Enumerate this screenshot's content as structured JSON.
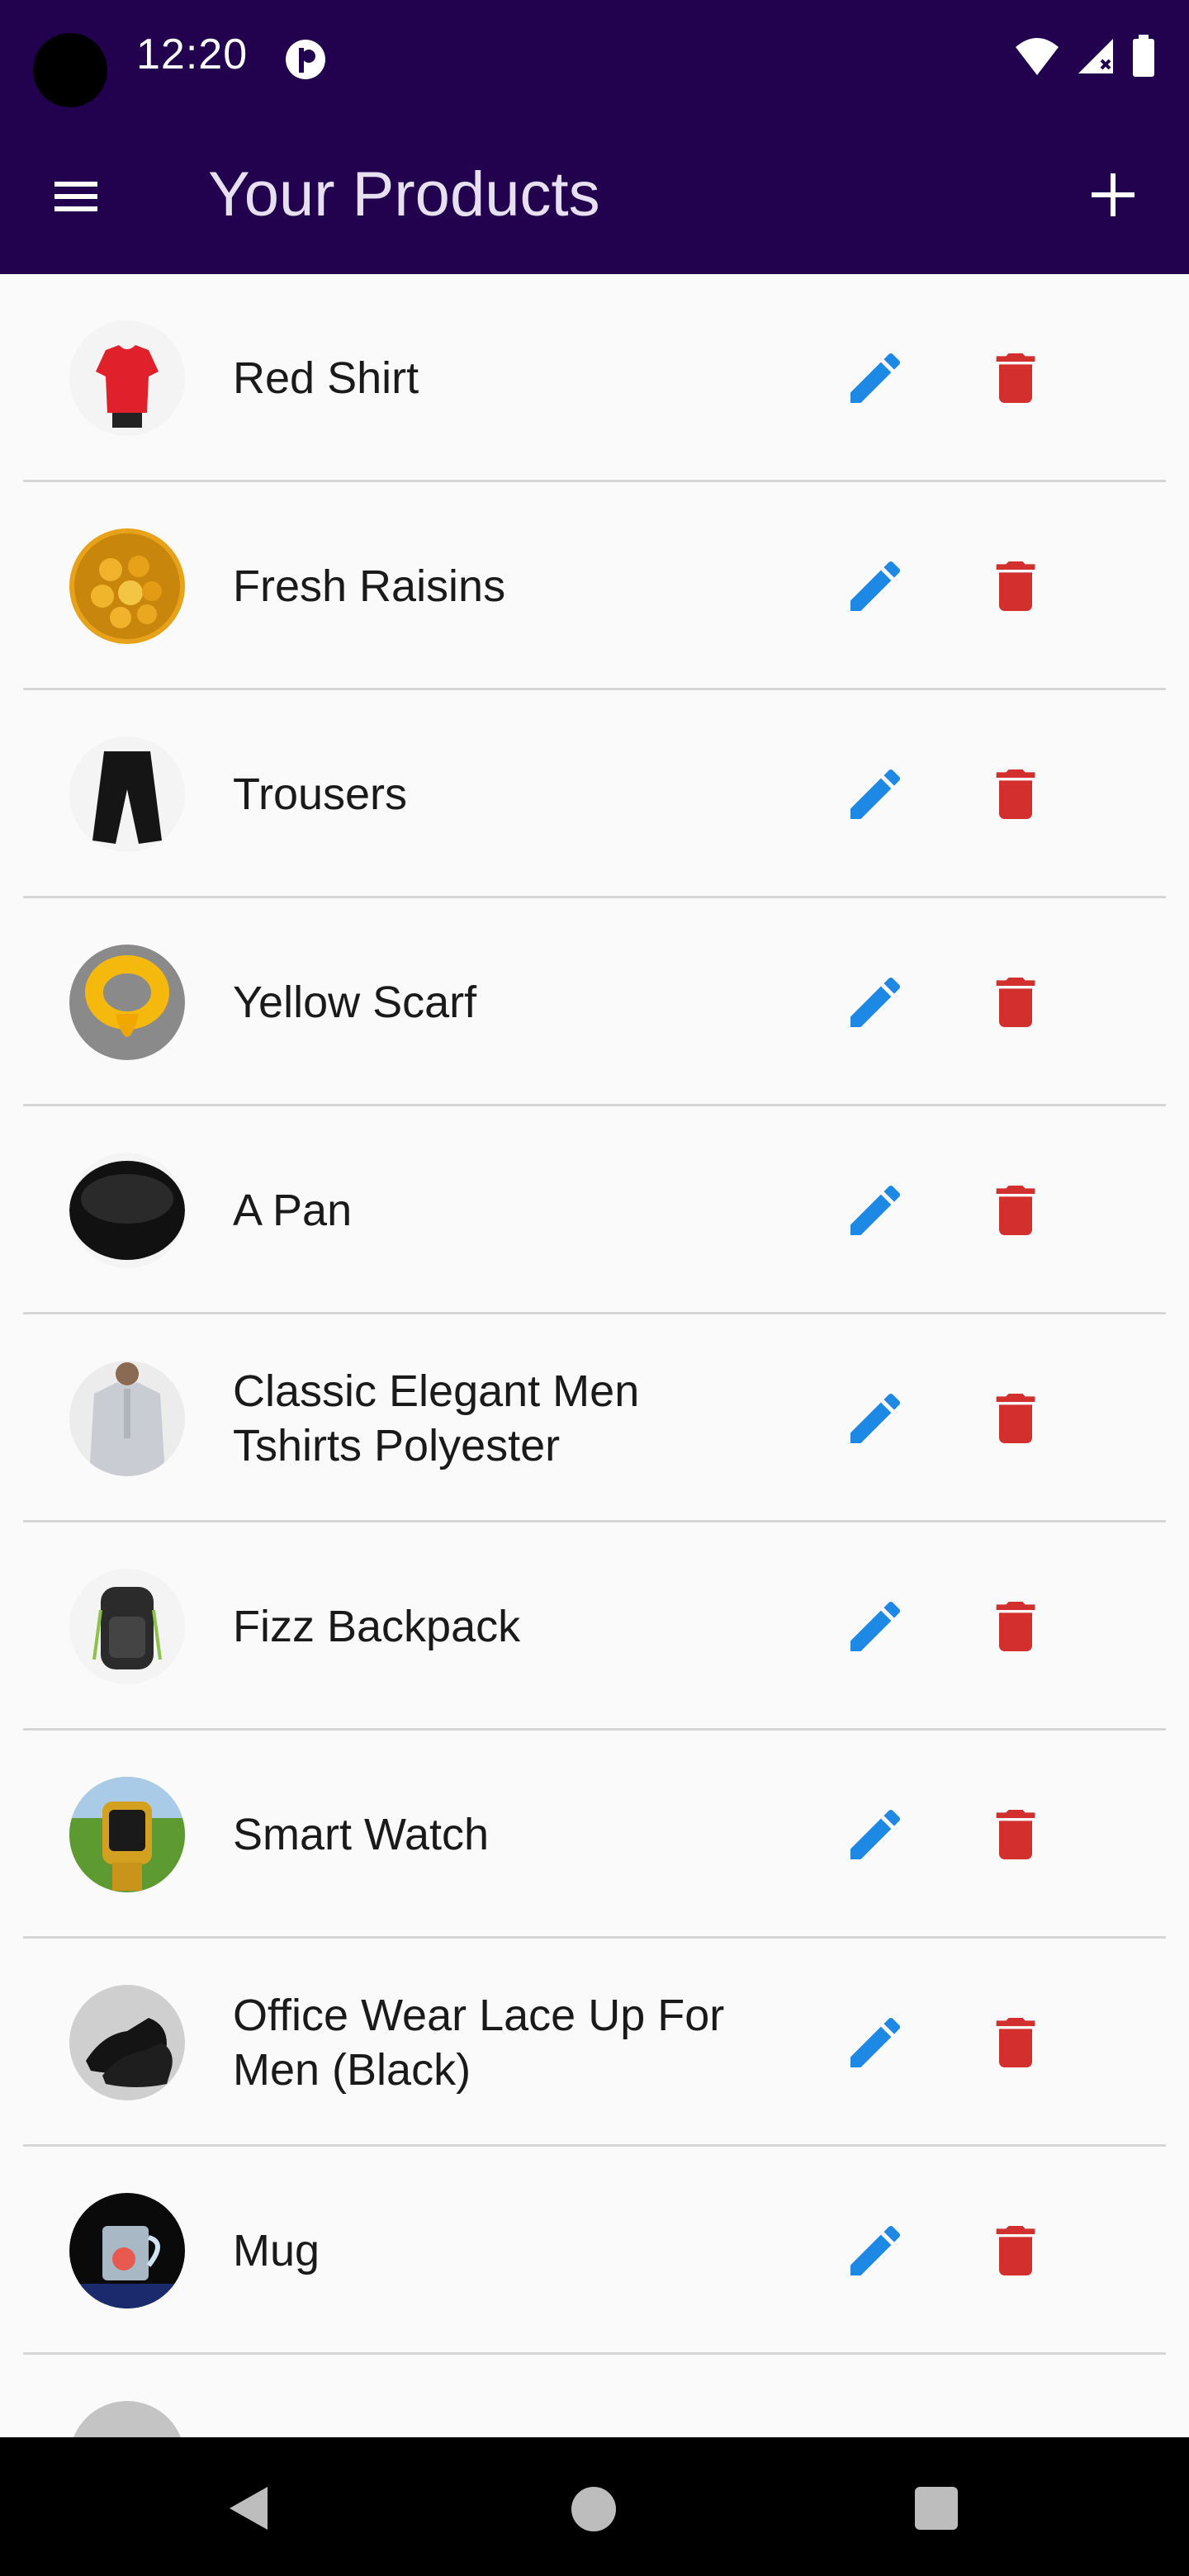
{
  "status_bar": {
    "time": "12:20"
  },
  "app_bar": {
    "title": "Your Products",
    "menu_icon": "menu-icon",
    "add_icon": "add-icon"
  },
  "colors": {
    "primary": "#22014f",
    "edit": "#1e88e5",
    "delete": "#d32f2f"
  },
  "products": [
    {
      "name": "Red Shirt"
    },
    {
      "name": "Fresh Raisins"
    },
    {
      "name": "Trousers"
    },
    {
      "name": "Yellow Scarf"
    },
    {
      "name": "A Pan"
    },
    {
      "name": "Classic Elegant Men\nTshirts Polyester"
    },
    {
      "name": "Fizz Backpack"
    },
    {
      "name": "Smart Watch"
    },
    {
      "name": "Office Wear Lace Up For\nMen  (Black)"
    },
    {
      "name": "Mug"
    }
  ]
}
